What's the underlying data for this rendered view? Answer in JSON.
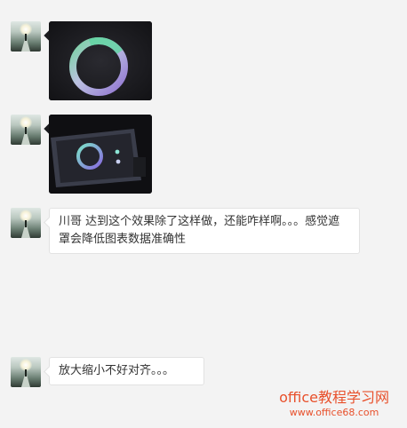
{
  "messages": [
    {
      "type": "image",
      "content": "donut chart photo"
    },
    {
      "type": "image",
      "content": "laptop screen photo"
    },
    {
      "type": "text",
      "text": "川哥  达到这个效果除了这样做，还能咋样啊。。。感觉遮罩会降低图表数据准确性"
    },
    {
      "type": "text",
      "text": "放大缩小不好对齐。。。"
    }
  ],
  "watermark": {
    "title": "office教程学习网",
    "url": "www.office68.com"
  },
  "colors": {
    "background": "#f3f3f3",
    "bubble": "#ffffff",
    "watermark": "#e8502b"
  }
}
